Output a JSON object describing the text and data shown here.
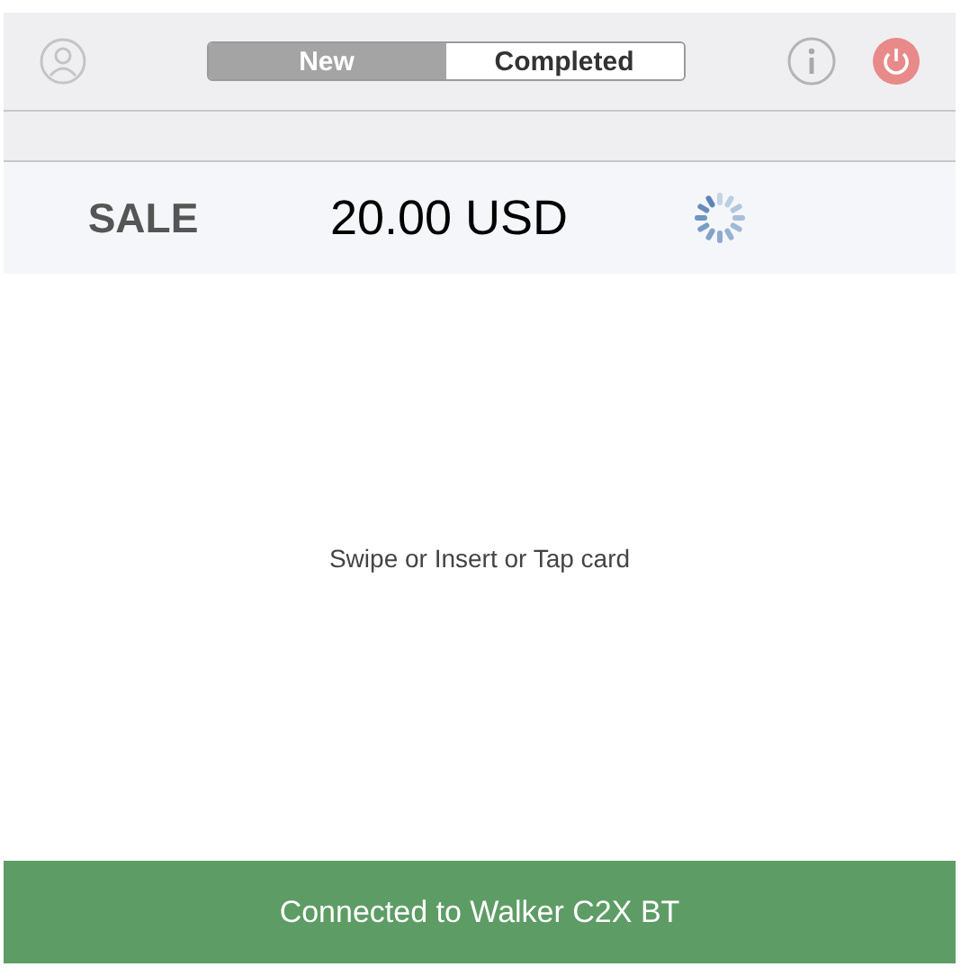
{
  "tabs": [
    {
      "label": "New",
      "selected": true
    },
    {
      "label": "Completed",
      "selected": false
    }
  ],
  "transaction": {
    "type": "SALE",
    "amount": "20.00 USD",
    "loading": true
  },
  "prompt": "Swipe or Insert or Tap card",
  "status_bar": {
    "text": "Connected to Walker C2X BT",
    "connected": true
  }
}
